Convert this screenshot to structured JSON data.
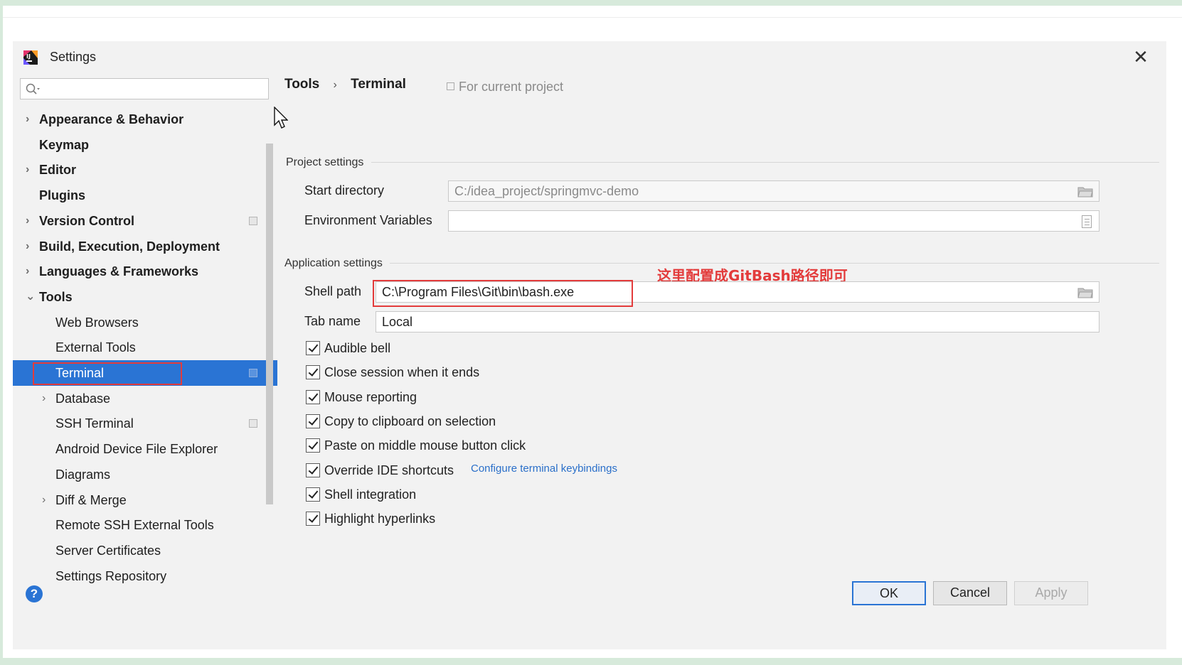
{
  "window": {
    "title": "Settings",
    "close_glyph": "✕"
  },
  "search": {
    "placeholder": "",
    "value": ""
  },
  "sidebar": {
    "items": [
      {
        "label": "Appearance & Behavior",
        "expandable": true,
        "expanded": false,
        "level": 0,
        "bold": true
      },
      {
        "label": "Keymap",
        "expandable": false,
        "level": 0,
        "bold": true
      },
      {
        "label": "Editor",
        "expandable": true,
        "expanded": false,
        "level": 0,
        "bold": true
      },
      {
        "label": "Plugins",
        "expandable": false,
        "level": 0,
        "bold": true
      },
      {
        "label": "Version Control",
        "expandable": true,
        "expanded": false,
        "level": 0,
        "bold": true,
        "project_icon": true
      },
      {
        "label": "Build, Execution, Deployment",
        "expandable": true,
        "expanded": false,
        "level": 0,
        "bold": true
      },
      {
        "label": "Languages & Frameworks",
        "expandable": true,
        "expanded": false,
        "level": 0,
        "bold": true
      },
      {
        "label": "Tools",
        "expandable": true,
        "expanded": true,
        "level": 0,
        "bold": true
      },
      {
        "label": "Web Browsers",
        "expandable": false,
        "level": 1
      },
      {
        "label": "External Tools",
        "expandable": false,
        "level": 1
      },
      {
        "label": "Terminal",
        "expandable": false,
        "level": 1,
        "selected": true,
        "project_icon": true
      },
      {
        "label": "Database",
        "expandable": true,
        "expanded": false,
        "level": 1
      },
      {
        "label": "SSH Terminal",
        "expandable": false,
        "level": 1,
        "project_icon": true
      },
      {
        "label": "Android Device File Explorer",
        "expandable": false,
        "level": 1
      },
      {
        "label": "Diagrams",
        "expandable": false,
        "level": 1
      },
      {
        "label": "Diff & Merge",
        "expandable": true,
        "expanded": false,
        "level": 1
      },
      {
        "label": "Remote SSH External Tools",
        "expandable": false,
        "level": 1
      },
      {
        "label": "Server Certificates",
        "expandable": false,
        "level": 1
      },
      {
        "label": "Settings Repository",
        "expandable": false,
        "level": 1
      }
    ]
  },
  "breadcrumb": {
    "parent": "Tools",
    "separator": "›",
    "current": "Terminal"
  },
  "scope": {
    "label": "For current project"
  },
  "project_settings": {
    "section_label": "Project settings",
    "start_directory": {
      "label": "Start directory",
      "value": "C:/idea_project/springmvc-demo"
    },
    "env_vars": {
      "label": "Environment Variables",
      "value": ""
    }
  },
  "application_settings": {
    "section_label": "Application settings",
    "shell_path": {
      "label": "Shell path",
      "value": "C:\\Program Files\\Git\\bin\\bash.exe"
    },
    "tab_name": {
      "label": "Tab name",
      "value": "Local"
    },
    "annotation": "这里配置成GitBash路径即可",
    "checkboxes": [
      {
        "label": "Audible bell",
        "checked": true
      },
      {
        "label": "Close session when it ends",
        "checked": true
      },
      {
        "label": "Mouse reporting",
        "checked": true
      },
      {
        "label": "Copy to clipboard on selection",
        "checked": true
      },
      {
        "label": "Paste on middle mouse button click",
        "checked": true
      },
      {
        "label": "Override IDE shortcuts",
        "checked": true
      },
      {
        "label": "Shell integration",
        "checked": true
      },
      {
        "label": "Highlight hyperlinks",
        "checked": true
      }
    ],
    "keybindings_link": "Configure terminal keybindings"
  },
  "footer": {
    "help": "?",
    "ok": "OK",
    "cancel": "Cancel",
    "apply": "Apply"
  },
  "colors": {
    "accent": "#2a74d4",
    "annotation_red": "#e33b3b",
    "link": "#2a6fc9"
  },
  "icons": {
    "app": "intellij-logo-icon",
    "search": "search-icon",
    "folder": "folder-icon",
    "env_editor": "document-icon",
    "help": "help-icon",
    "close": "close-icon"
  }
}
